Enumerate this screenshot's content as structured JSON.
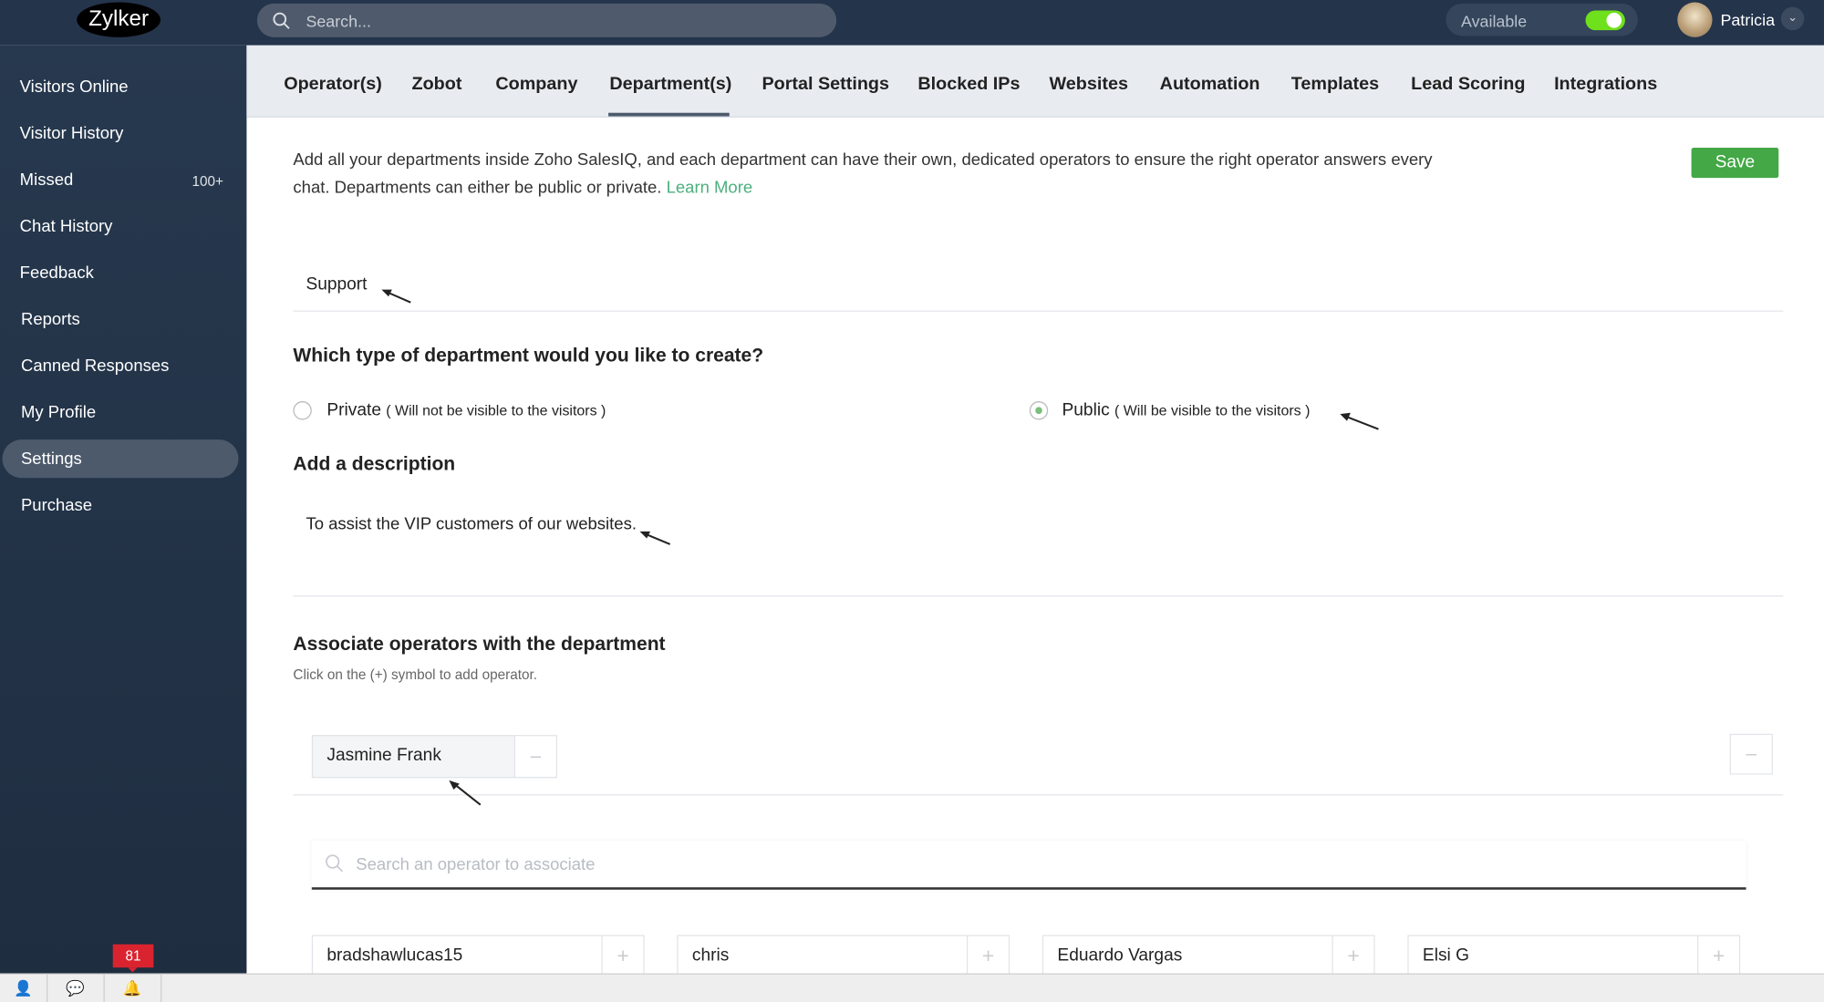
{
  "topbar": {
    "logo": "Zylker",
    "search_placeholder": "Search...",
    "status_label": "Available",
    "status_on": true,
    "user_name": "Patricia"
  },
  "sidebar": {
    "items": [
      {
        "label": "Visitors Online"
      },
      {
        "label": "Visitor History"
      },
      {
        "label": "Missed",
        "count": "100+"
      },
      {
        "label": "Chat History"
      },
      {
        "label": "Feedback"
      },
      {
        "label": "Reports"
      },
      {
        "label": "Canned Responses"
      },
      {
        "label": "My Profile"
      },
      {
        "label": "Settings",
        "active": true
      },
      {
        "label": "Purchase"
      }
    ]
  },
  "tabs": [
    "Operator(s)",
    "Zobot",
    "Company",
    "Department(s)",
    "Portal Settings",
    "Blocked IPs",
    "Websites",
    "Automation",
    "Templates",
    "Lead Scoring",
    "Integrations"
  ],
  "active_tab": "Department(s)",
  "intro": {
    "line1": "Add all your departments inside Zoho SalesIQ, and each department can have their own, dedicated operators to ensure the right operator answers every",
    "line2": "chat. Departments can either be public or private.",
    "learn_more": "Learn More"
  },
  "save_label": "Save",
  "department_name": "Support",
  "type_question": "Which type of department would you like to create?",
  "private": {
    "label": "Private",
    "note": "( Will not be visible to the visitors )",
    "selected": false
  },
  "public": {
    "label": "Public",
    "note": "( Will be visible to the visitors )",
    "selected": true
  },
  "description_heading": "Add a description",
  "description": "To assist the VIP customers of our websites.",
  "associate": {
    "heading": "Associate operators with the department",
    "hint": "Click on the (+) symbol to add operator.",
    "selected": [
      "Jasmine Frank"
    ],
    "search_placeholder": "Search an operator to associate",
    "operators": [
      "bradshawlucas15",
      "chris",
      "Eduardo Vargas",
      "Elsi G"
    ]
  },
  "notifications_count": "81",
  "colors": {
    "topbar": "#24344b",
    "save": "#43a845",
    "link": "#4caf7d",
    "toggle": "#6fe01c",
    "badge": "#d9242f"
  }
}
